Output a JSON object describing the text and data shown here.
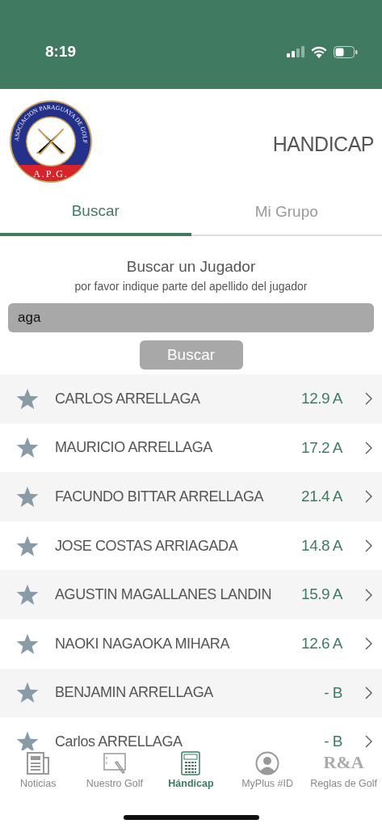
{
  "status_bar": {
    "time": "8:19"
  },
  "header": {
    "logo": {
      "ring_text": "ASOCIACION PARAGUAYA DE GOLF",
      "band_text": "A.P.G."
    },
    "title": "HANDICAP"
  },
  "tabs": [
    {
      "label": "Buscar",
      "selected": true
    },
    {
      "label": "Mi Grupo",
      "selected": false
    }
  ],
  "search": {
    "title": "Buscar un Jugador",
    "subtitle": "por favor indique parte del apellido del jugador",
    "value": "aga",
    "button": "Buscar"
  },
  "players": [
    {
      "name": "CARLOS ARRELLAGA",
      "handicap": "12.9 A"
    },
    {
      "name": "MAURICIO ARRELLAGA",
      "handicap": "17.2 A"
    },
    {
      "name": "FACUNDO BITTAR ARRELLAGA",
      "handicap": "21.4 A"
    },
    {
      "name": "JOSE COSTAS ARRIAGADA",
      "handicap": "14.8 A"
    },
    {
      "name": "AGUSTIN MAGALLANES LANDIN",
      "handicap": "15.9 A"
    },
    {
      "name": "NAOKI NAGAOKA MIHARA",
      "handicap": "12.6 A"
    },
    {
      "name": "BENJAMIN ARRELLAGA",
      "handicap": "- B"
    },
    {
      "name": "Carlos ARRELLAGA",
      "handicap": "- B"
    }
  ],
  "tab_bar": [
    {
      "label": "Noticias",
      "kind": "newspaper",
      "selected": false
    },
    {
      "label": "Nuestro Golf",
      "kind": "tablet",
      "selected": false
    },
    {
      "label": "Hándicap",
      "kind": "calculator",
      "selected": true
    },
    {
      "label": "MyPlus #ID",
      "kind": "person",
      "selected": false
    },
    {
      "label": "Reglas de Golf",
      "kind": "letters",
      "icon_text": "R&A",
      "selected": false
    }
  ]
}
